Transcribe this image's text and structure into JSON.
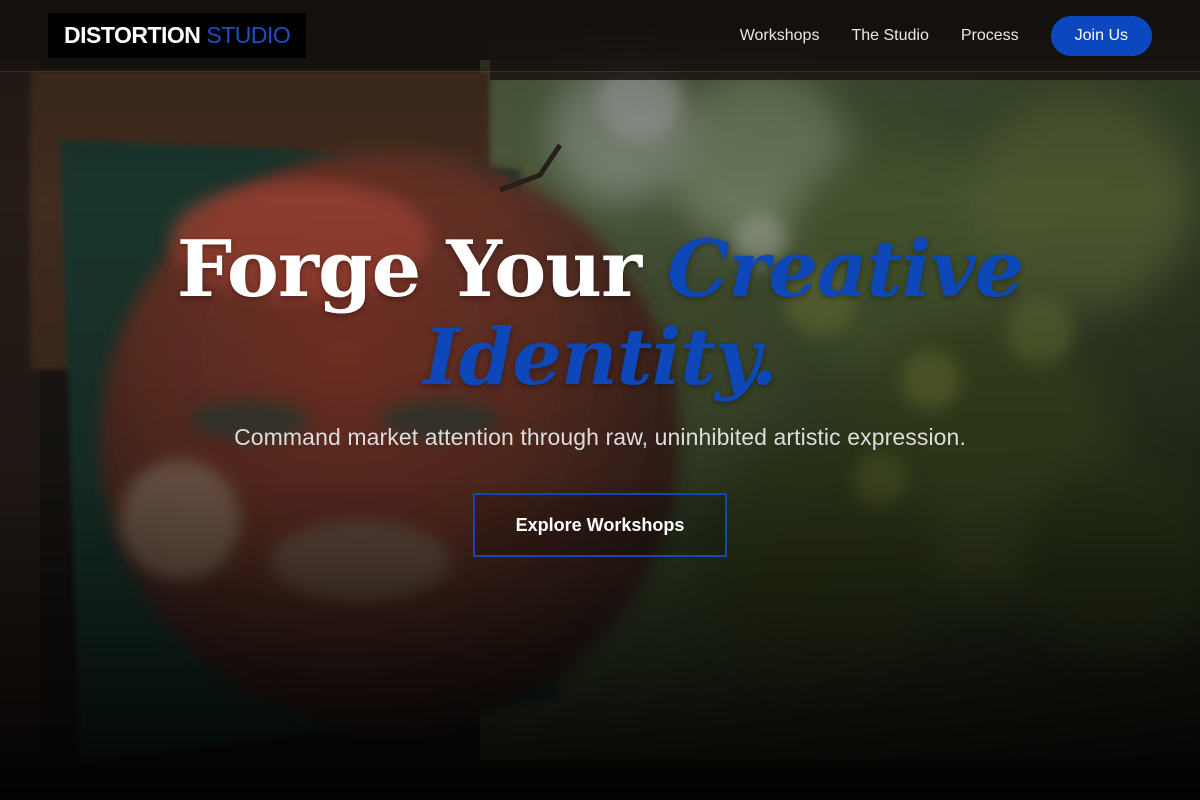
{
  "header": {
    "logo": {
      "primary": "DISTORTION",
      "accent": "STUDIO"
    },
    "nav": {
      "workshops": "Workshops",
      "studio": "The Studio",
      "process": "Process",
      "join": "Join Us"
    }
  },
  "hero": {
    "title_plain": "Forge Your",
    "title_accent_1": "Creative",
    "title_accent_2": "Identity.",
    "subtitle": "Command market attention through raw, uninhibited artistic expression.",
    "cta": "Explore Workshops"
  },
  "colors": {
    "accent": "#0d47b8",
    "button": "#0b48bf",
    "background": "#0b0b0c"
  }
}
